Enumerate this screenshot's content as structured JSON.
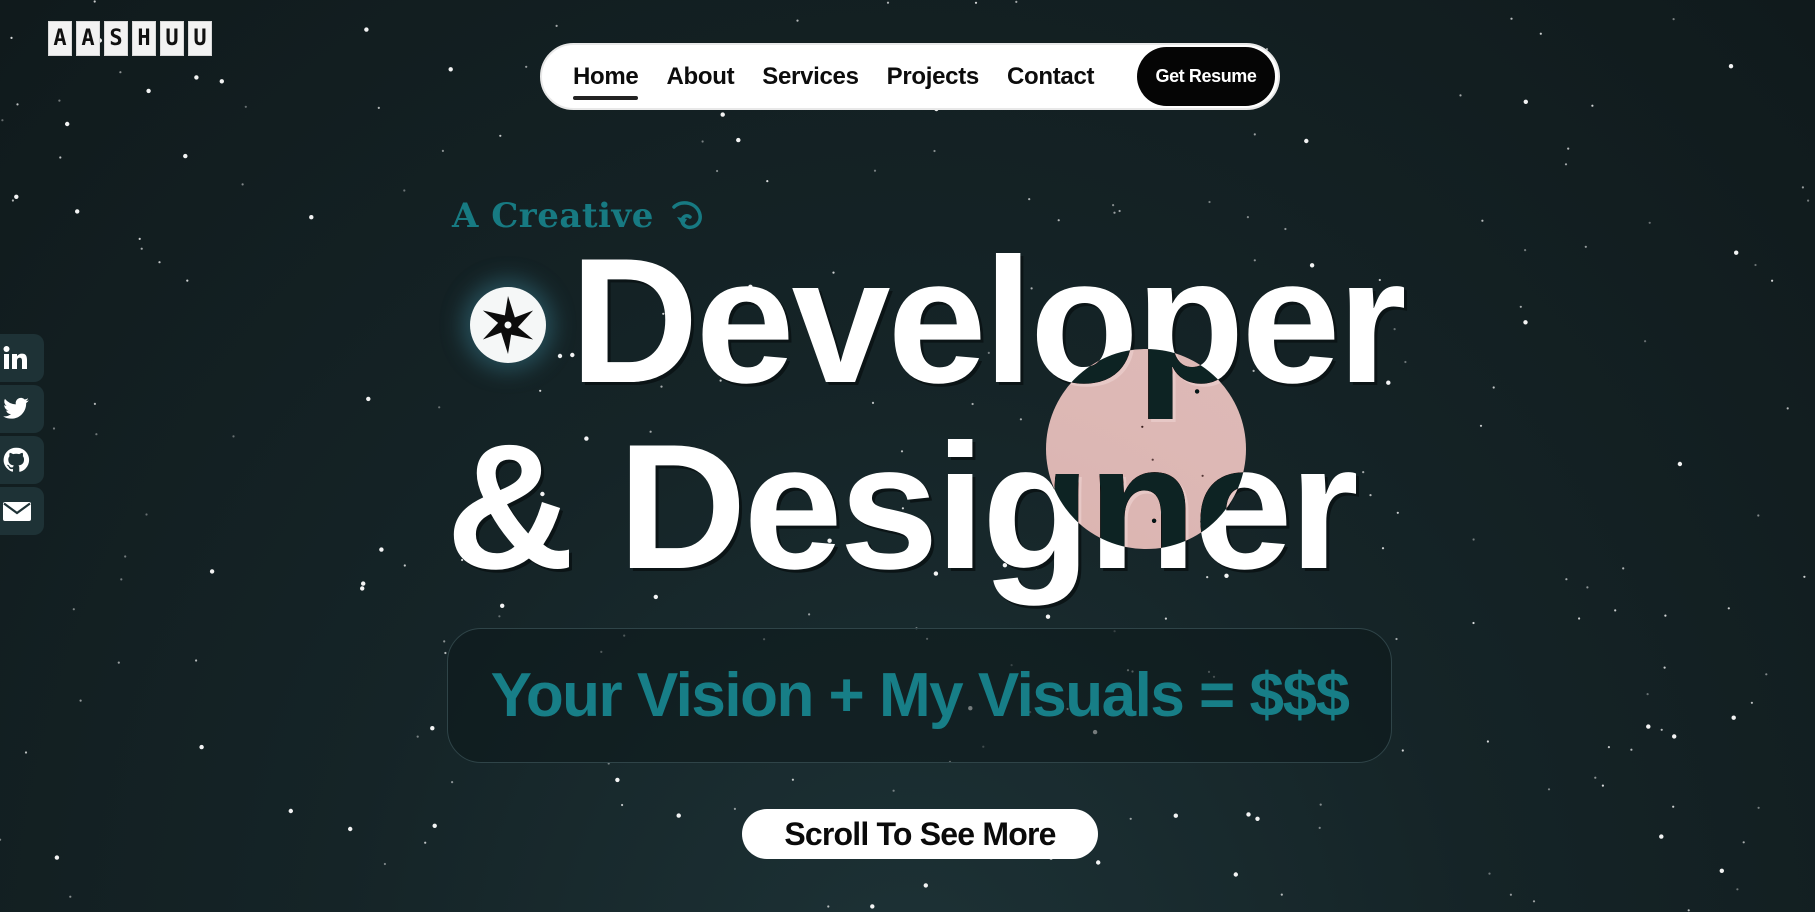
{
  "logo": {
    "letters": [
      "A",
      "A",
      "S",
      "H",
      "U",
      "U"
    ]
  },
  "nav": {
    "links": [
      {
        "label": "Home",
        "active": true
      },
      {
        "label": "About",
        "active": false
      },
      {
        "label": "Services",
        "active": false
      },
      {
        "label": "Projects",
        "active": false
      },
      {
        "label": "Contact",
        "active": false
      }
    ],
    "resume_label": "Get Resume"
  },
  "socials": [
    {
      "icon": "linkedin-icon"
    },
    {
      "icon": "twitter-icon"
    },
    {
      "icon": "github-icon"
    },
    {
      "icon": "email-icon"
    }
  ],
  "hero": {
    "tagline": "A Creative",
    "headline_line1": "Developer",
    "headline_line2": "& Designer",
    "vision": "Your Vision + My Visuals = $$$",
    "scroll_label": "Scroll To See More"
  },
  "colors": {
    "background": "#152427",
    "accent_teal": "#177e87",
    "cursor_blob": "#f2dcdc"
  }
}
